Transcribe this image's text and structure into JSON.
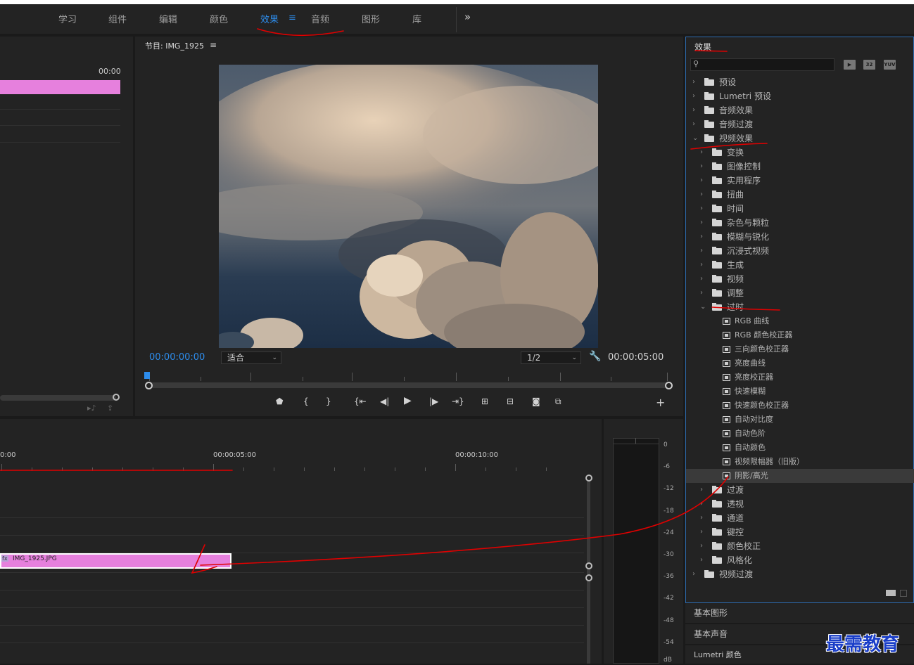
{
  "workspaces": {
    "tabs": [
      {
        "label": "学习"
      },
      {
        "label": "组件"
      },
      {
        "label": "编辑"
      },
      {
        "label": "颜色"
      },
      {
        "label": "效果",
        "active": true
      },
      {
        "label": "音频"
      },
      {
        "label": "图形"
      },
      {
        "label": "库"
      }
    ],
    "menu_icon": "≡",
    "more": "»"
  },
  "source_panel": {
    "timecode": "00:00"
  },
  "program": {
    "title": "节目: IMG_1925",
    "menu_icon": "≡",
    "timecode": "00:00:00:00",
    "fit": "适合",
    "resolution": "1/2",
    "duration": "00:00:05:00",
    "playhead_progress": 0
  },
  "timeline": {
    "ruler": [
      "0:00",
      "00:00:05:00",
      "00:00:10:00"
    ],
    "clip_name": "IMG_1925.JPG",
    "clip_badge": "fx"
  },
  "meter": {
    "scale": [
      "0",
      "-6",
      "-12",
      "-18",
      "-24",
      "-30",
      "-36",
      "-42",
      "-48",
      "-54",
      "dB"
    ]
  },
  "effects": {
    "title": "效果",
    "search_placeholder": "",
    "type_buttons": [
      "▶",
      "32",
      "YUV"
    ],
    "tree": [
      {
        "label": "预设",
        "kind": "preset",
        "level": 0,
        "open": false
      },
      {
        "label": "Lumetri 预设",
        "kind": "preset",
        "level": 0,
        "open": false
      },
      {
        "label": "音频效果",
        "kind": "folder",
        "level": 0,
        "open": false
      },
      {
        "label": "音频过渡",
        "kind": "folder",
        "level": 0,
        "open": false
      },
      {
        "label": "视频效果",
        "kind": "folder",
        "level": 0,
        "open": true
      },
      {
        "label": "变换",
        "kind": "folder",
        "level": 1,
        "open": false
      },
      {
        "label": "图像控制",
        "kind": "folder",
        "level": 1,
        "open": false
      },
      {
        "label": "实用程序",
        "kind": "folder",
        "level": 1,
        "open": false
      },
      {
        "label": "扭曲",
        "kind": "folder",
        "level": 1,
        "open": false
      },
      {
        "label": "时间",
        "kind": "folder",
        "level": 1,
        "open": false
      },
      {
        "label": "杂色与颗粒",
        "kind": "folder",
        "level": 1,
        "open": false
      },
      {
        "label": "模糊与锐化",
        "kind": "folder",
        "level": 1,
        "open": false
      },
      {
        "label": "沉浸式视频",
        "kind": "folder",
        "level": 1,
        "open": false
      },
      {
        "label": "生成",
        "kind": "folder",
        "level": 1,
        "open": false
      },
      {
        "label": "视频",
        "kind": "folder",
        "level": 1,
        "open": false
      },
      {
        "label": "调整",
        "kind": "folder",
        "level": 1,
        "open": false
      },
      {
        "label": "过时",
        "kind": "folder",
        "level": 1,
        "open": true
      },
      {
        "label": "RGB 曲线",
        "kind": "effect",
        "level": 2
      },
      {
        "label": "RGB 颜色校正器",
        "kind": "effect",
        "level": 2
      },
      {
        "label": "三向颜色校正器",
        "kind": "effect",
        "level": 2
      },
      {
        "label": "亮度曲线",
        "kind": "effect",
        "level": 2
      },
      {
        "label": "亮度校正器",
        "kind": "effect",
        "level": 2
      },
      {
        "label": "快速模糊",
        "kind": "effect",
        "level": 2
      },
      {
        "label": "快速颜色校正器",
        "kind": "effect",
        "level": 2
      },
      {
        "label": "自动对比度",
        "kind": "effect",
        "level": 2
      },
      {
        "label": "自动色阶",
        "kind": "effect",
        "level": 2
      },
      {
        "label": "自动颜色",
        "kind": "effect",
        "level": 2
      },
      {
        "label": "视频限幅器（旧版）",
        "kind": "effect",
        "level": 2
      },
      {
        "label": "阴影/高光",
        "kind": "effect",
        "level": 2,
        "selected": true
      },
      {
        "label": "过渡",
        "kind": "folder",
        "level": 1,
        "open": false
      },
      {
        "label": "透视",
        "kind": "folder",
        "level": 1,
        "open": false
      },
      {
        "label": "通道",
        "kind": "folder",
        "level": 1,
        "open": false
      },
      {
        "label": "键控",
        "kind": "folder",
        "level": 1,
        "open": false
      },
      {
        "label": "颜色校正",
        "kind": "folder",
        "level": 1,
        "open": false
      },
      {
        "label": "风格化",
        "kind": "folder",
        "level": 1,
        "open": false
      },
      {
        "label": "视频过渡",
        "kind": "folder",
        "level": 0,
        "open": false
      }
    ]
  },
  "side_panels": [
    "基本图形",
    "基本声音",
    "Lumetri 颜色"
  ],
  "watermark": "最需教育",
  "colors": {
    "accent": "#2d8ceb",
    "clip": "#e680dd",
    "annotation": "#e00000"
  }
}
